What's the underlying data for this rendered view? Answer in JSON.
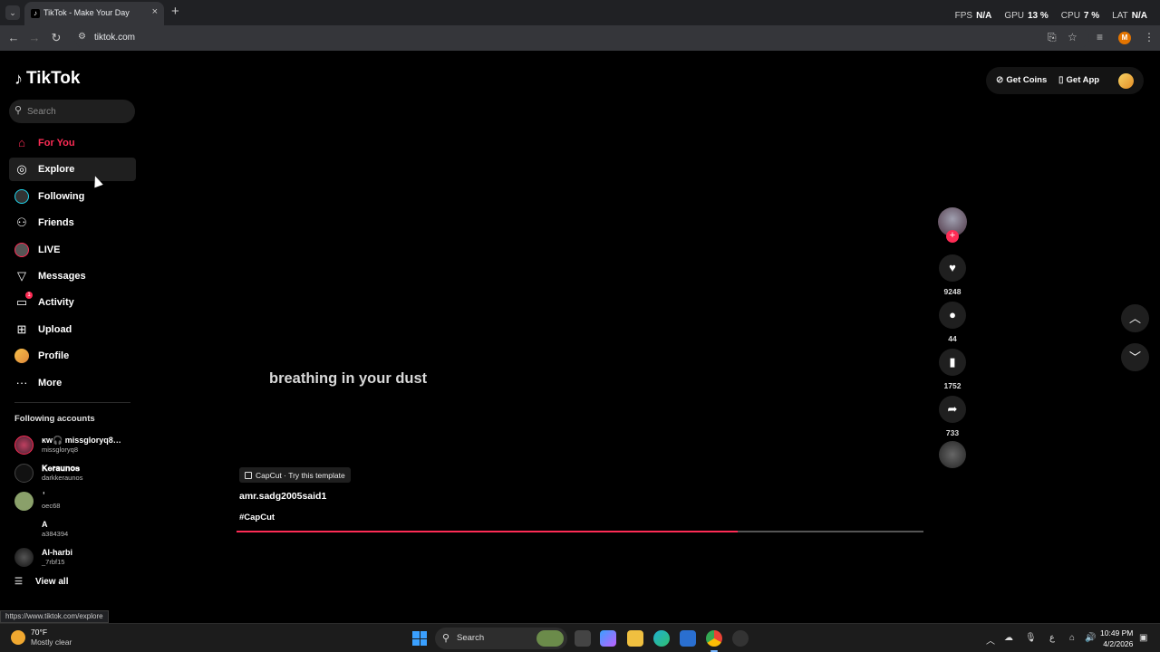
{
  "browser": {
    "tab_title": "TikTok - Make Your Day",
    "tab_close": "×",
    "new_tab": "+",
    "url": "tiktok.com",
    "perf": {
      "fps_label": "FPS",
      "fps_value": "N/A",
      "gpu_label": "GPU",
      "gpu_value": "13 %",
      "cpu_label": "CPU",
      "cpu_value": "7 %",
      "lat_label": "LAT",
      "lat_value": "N/A"
    },
    "profile_initial": "M"
  },
  "tiktok": {
    "logo_text": "TikTok",
    "search_placeholder": "Search",
    "nav": [
      {
        "label": "For You",
        "icon": "home-icon"
      },
      {
        "label": "Explore",
        "icon": "compass-icon"
      },
      {
        "label": "Following",
        "icon": "following-avatar-icon"
      },
      {
        "label": "Friends",
        "icon": "friends-icon"
      },
      {
        "label": "LIVE",
        "icon": "live-icon"
      },
      {
        "label": "Messages",
        "icon": "send-icon"
      },
      {
        "label": "Activity",
        "icon": "inbox-icon",
        "badge": "1"
      },
      {
        "label": "Upload",
        "icon": "plus-square-icon"
      },
      {
        "label": "Profile",
        "icon": "profile-avatar-icon"
      },
      {
        "label": "More",
        "icon": "more-dots-icon"
      }
    ],
    "following_accounts_title": "Following accounts",
    "accounts": [
      {
        "name": "ĸw🎧 missgloryq8…",
        "handle": "missgloryq8"
      },
      {
        "name": "𝐊𝐞𝐫𝐚𝐮𝐧𝐨𝐬",
        "handle": "darkkeraunos"
      },
      {
        "name": "ٰ",
        "handle": "oec68"
      },
      {
        "name": "A",
        "handle": "a384394"
      },
      {
        "name": "Al-harbi",
        "handle": "_7rbf15"
      }
    ],
    "view_all": "View all",
    "top_actions": {
      "coins": "Get Coins",
      "app": "Get App"
    },
    "video": {
      "caption_overlay": "breathing in your dust",
      "capcut_label": "CapCut · Try this template",
      "author": "amr.sadg2005said1",
      "hashtag": "#CapCut",
      "progress_fraction": 0.73
    },
    "actions": {
      "likes": "9248",
      "comments": "44",
      "saves": "1752",
      "shares": "733"
    },
    "status_url": "https://www.tiktok.com/explore"
  },
  "taskbar": {
    "weather_temp": "70°F",
    "weather_desc": "Mostly clear",
    "search_label": "Search",
    "time": "10:49 PM",
    "date": "4/2/2026"
  },
  "colors": {
    "accent": "#fe2c55",
    "page_bg": "#000000"
  }
}
